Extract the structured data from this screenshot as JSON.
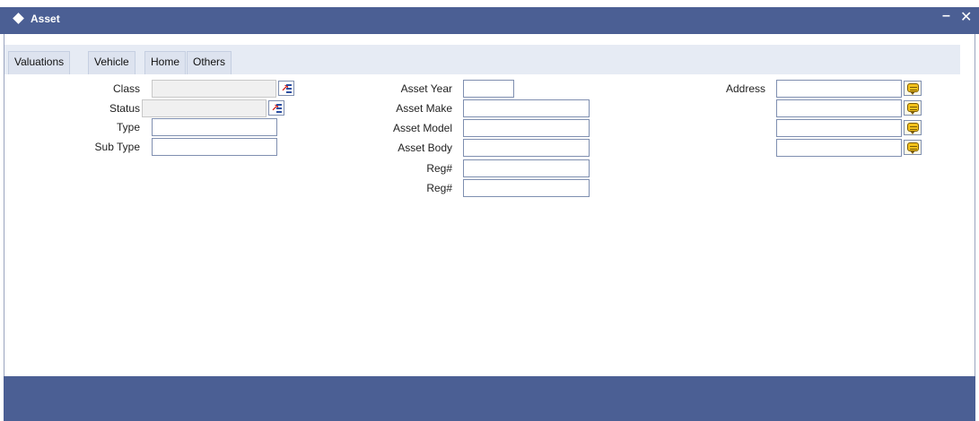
{
  "window": {
    "title": "Asset",
    "minimize_glyph": "–",
    "close_glyph": "✕"
  },
  "tabs": [
    {
      "label": "Valuations"
    },
    {
      "label": "Vehicle"
    },
    {
      "label": "Home"
    },
    {
      "label": "Others"
    }
  ],
  "left": {
    "class_label": "Class",
    "class_value": "",
    "status_label": "Status",
    "status_value": "",
    "type_label": "Type",
    "type_value": "",
    "subtype_label": "Sub Type",
    "subtype_value": ""
  },
  "middle": {
    "year_label": "Asset Year",
    "year_value": "",
    "make_label": "Asset Make",
    "make_value": "",
    "model_label": "Asset Model",
    "model_value": "",
    "body_label": "Asset Body",
    "body_value": "",
    "reg1_label": "Reg#",
    "reg1_value": "",
    "reg2_label": "Reg#",
    "reg2_value": ""
  },
  "right": {
    "address_label": "Address",
    "address_lines": [
      "",
      "",
      "",
      ""
    ]
  },
  "icons": {
    "lov": "list-of-values-icon",
    "address_detail": "comment-bubble-icon"
  },
  "colors": {
    "title_bar": "#4b5f94",
    "footer": "#4b5f94",
    "tab_strip": "#e6ebf4"
  }
}
